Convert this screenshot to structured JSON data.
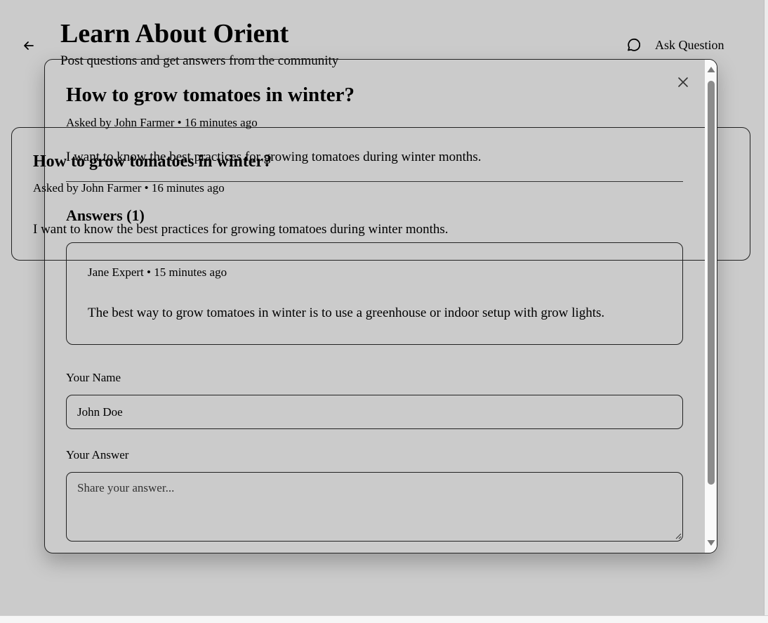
{
  "header": {
    "back_icon": "arrow-left-icon",
    "title": "Learn About Orient",
    "subtitle": "Post questions and get answers from the community",
    "ask_button": {
      "icon": "speech-bubble-icon",
      "label": "Ask Question"
    }
  },
  "question_card": {
    "title": "How to grow tomatoes in winter?",
    "meta": "Asked by John Farmer • 16 minutes ago",
    "body": "I want to know the best practices for growing tomatoes during winter months."
  },
  "modal": {
    "close_icon": "close-icon",
    "title": "How to grow tomatoes in winter?",
    "meta": "Asked by John Farmer • 16 minutes ago",
    "body": "I want to know the best practices for growing tomatoes during winter months.",
    "answers_heading": "Answers (1)",
    "answers": [
      {
        "meta": "Jane Expert • 15 minutes ago",
        "body": "The best way to grow tomatoes in winter is to use a greenhouse or indoor setup with grow lights."
      }
    ],
    "form": {
      "name_label": "Your Name",
      "name_value": "John Doe",
      "answer_label": "Your Answer",
      "answer_placeholder": "Share your answer..."
    }
  },
  "colors": {
    "backdrop": "#cbcbcb",
    "border": "#222222",
    "scroll_thumb": "#8c8c8c",
    "scroll_track": "#fafafa"
  }
}
